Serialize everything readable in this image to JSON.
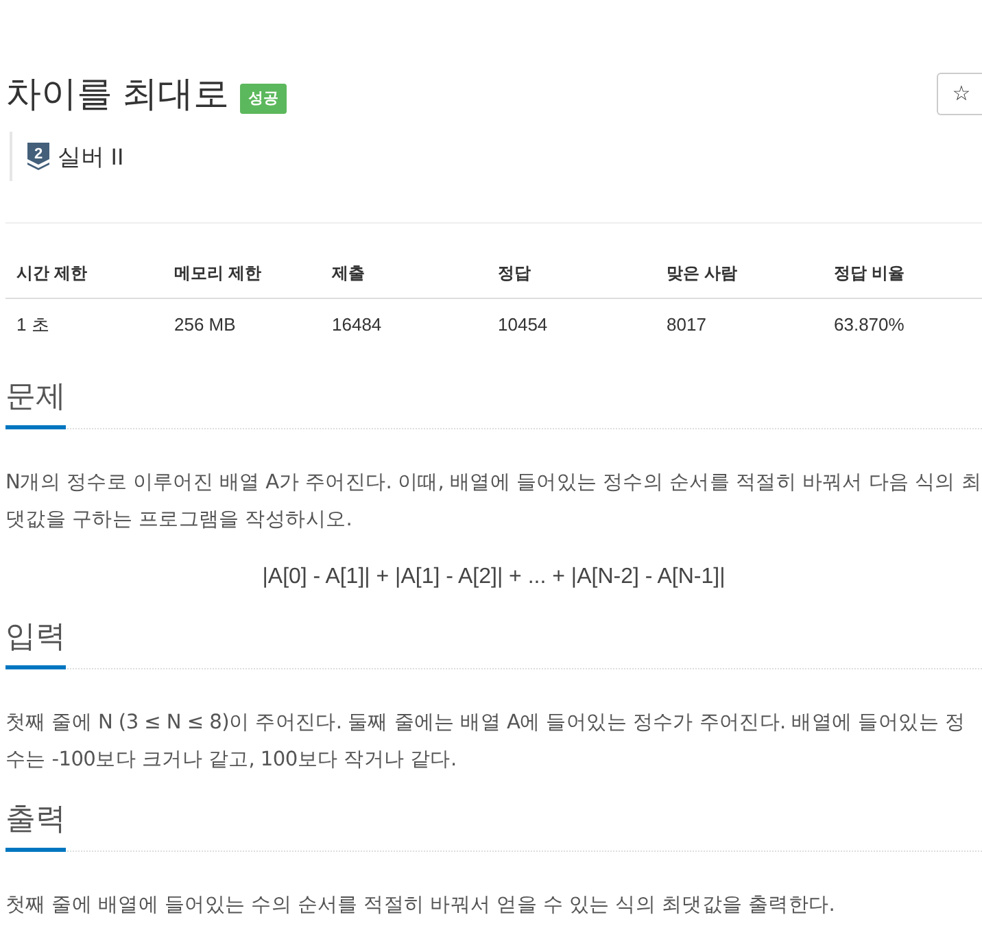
{
  "problem": {
    "title": "차이를 최대로",
    "result_badge": "성공",
    "star_button": "☆"
  },
  "tier": {
    "rank": "2",
    "label": "실버 II"
  },
  "stats_table": {
    "columns": [
      "시간 제한",
      "메모리 제한",
      "제출",
      "정답",
      "맞은 사람",
      "정답 비율"
    ],
    "rows": [
      [
        "1 초",
        "256 MB",
        "16484",
        "10454",
        "8017",
        "63.870%"
      ]
    ]
  },
  "sections": [
    {
      "heading": "문제",
      "blocks": [
        {
          "kind": "paragraph",
          "text": "N개의 정수로 이루어진 배열 A가 주어진다. 이때, 배열에 들어있는 정수의 순서를 적절히 바꿔서 다음 식의 최댓값을 구하는 프로그램을 작성하시오."
        },
        {
          "kind": "formula",
          "text": "|A[0] - A[1]| + |A[1] - A[2]| + ... + |A[N-2] - A[N-1]|"
        }
      ]
    },
    {
      "heading": "입력",
      "blocks": [
        {
          "kind": "paragraph",
          "text": "첫째 줄에 N (3 ≤ N ≤ 8)이 주어진다. 둘째 줄에는 배열 A에 들어있는 정수가 주어진다. 배열에 들어있는 정수는 -100보다 크거나 같고, 100보다 작거나 같다."
        }
      ]
    },
    {
      "heading": "출력",
      "blocks": [
        {
          "kind": "paragraph",
          "text": "첫째 줄에 배열에 들어있는 수의 순서를 적절히 바꿔서 얻을 수 있는 식의 최댓값을 출력한다."
        }
      ]
    }
  ]
}
